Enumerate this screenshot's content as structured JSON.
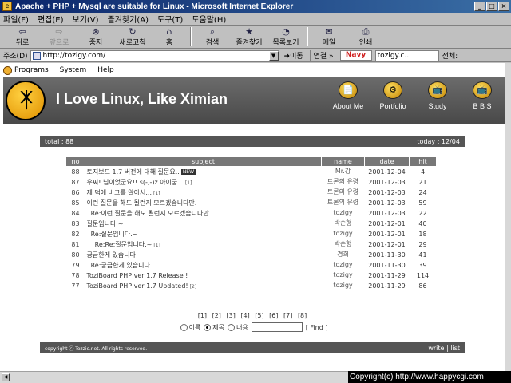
{
  "window": {
    "title": "Apache + PHP + Mysql are suitable for Linux - Microsoft Internet Explorer",
    "buttons": [
      "_",
      "□",
      "×"
    ]
  },
  "menu": [
    "파일(F)",
    "편집(E)",
    "보기(V)",
    "즐겨찾기(A)",
    "도구(T)",
    "도움말(H)"
  ],
  "toolbar": {
    "back": "뒤로",
    "forward": "앞으로",
    "stop": "중지",
    "refresh": "새로고침",
    "home": "홈",
    "search": "검색",
    "favorites": "즐겨찾기",
    "history": "목록보기",
    "mail": "메일",
    "print": "인쇄"
  },
  "address": {
    "label": "주소(D)",
    "url": "http://tozigy.com/",
    "go": "이동",
    "links": "연결 »",
    "navy": "Navy",
    "search_value": "tozigy.c..",
    "all": "전체:"
  },
  "app_menu": [
    "Programs",
    "System",
    "Help"
  ],
  "banner": {
    "title": "I Love Linux, Like Ximian",
    "nav": [
      {
        "label": "About Me",
        "icon": "📄"
      },
      {
        "label": "Portfolio",
        "icon": "⚙"
      },
      {
        "label": "Study",
        "icon": "📺"
      },
      {
        "label": "B B S",
        "icon": "📺"
      }
    ]
  },
  "board": {
    "total": "total : 88",
    "today": "today :  12/04",
    "headers": [
      "no",
      "subject",
      "name",
      "date",
      "hit"
    ],
    "rows": [
      {
        "no": "88",
        "subject": "토지보드 1.7 버전에 대해 질문요..",
        "badge": "NEW",
        "comments": "",
        "name": "Mr.강",
        "date": "2001-12-04",
        "hit": "4"
      },
      {
        "no": "87",
        "subject": "우씨! 님이었군요!! s(-,-)z 아이궁...",
        "badge": "",
        "comments": "[1]",
        "name": "트론의 유령",
        "date": "2001-12-03",
        "hit": "21"
      },
      {
        "no": "86",
        "subject": "제 덕에 버그를 알아서...",
        "badge": "",
        "comments": "[1]",
        "name": "트론의 유령",
        "date": "2001-12-03",
        "hit": "24"
      },
      {
        "no": "85",
        "subject": "이런 질문을 해도 될런지 모르겠습니다만.",
        "badge": "",
        "comments": "",
        "name": "트론의 유령",
        "date": "2001-12-03",
        "hit": "59"
      },
      {
        "no": "84",
        "subject": "  Re:이런 질문을 해도 될런지 모르겠습니다만.",
        "badge": "",
        "comments": "",
        "name": "tozigy",
        "date": "2001-12-03",
        "hit": "22"
      },
      {
        "no": "83",
        "subject": "질문입니다.~",
        "badge": "",
        "comments": "",
        "name": "박순형",
        "date": "2001-12-01",
        "hit": "40"
      },
      {
        "no": "82",
        "subject": "  Re:질문입니다.~",
        "badge": "",
        "comments": "",
        "name": "tozigy",
        "date": "2001-12-01",
        "hit": "18"
      },
      {
        "no": "81",
        "subject": "    Re:Re:질문입니다.~",
        "badge": "",
        "comments": "[1]",
        "name": "박순형",
        "date": "2001-12-01",
        "hit": "29"
      },
      {
        "no": "80",
        "subject": "궁금한게 있습니다",
        "badge": "",
        "comments": "",
        "name": "경희",
        "date": "2001-11-30",
        "hit": "41"
      },
      {
        "no": "79",
        "subject": "  Re:궁금한게 있습니다",
        "badge": "",
        "comments": "",
        "name": "tozigy",
        "date": "2001-11-30",
        "hit": "39"
      },
      {
        "no": "78",
        "subject": "ToziBoard PHP ver 1.7 Release !",
        "badge": "",
        "comments": "",
        "name": "tozigy",
        "date": "2001-11-29",
        "hit": "114"
      },
      {
        "no": "77",
        "subject": "ToziBoard PHP ver 1.7 Updated!",
        "badge": "",
        "comments": "[2]",
        "name": "tozigy",
        "date": "2001-11-29",
        "hit": "86"
      }
    ],
    "pages": [
      "[1]",
      "[2]",
      "[3]",
      "[4]",
      "[5]",
      "[6]",
      "[7]",
      "[8]"
    ],
    "search": {
      "opt_name": "이름",
      "opt_subject": "제목",
      "opt_content": "내용",
      "find": "[ Find ]"
    },
    "footer_copyright": "copyright ⓒ Tozzic.net. All rights reserved.",
    "write": "write",
    "list": "list"
  },
  "page_copyright": "Copyright(c) http://www.happycgi.com"
}
